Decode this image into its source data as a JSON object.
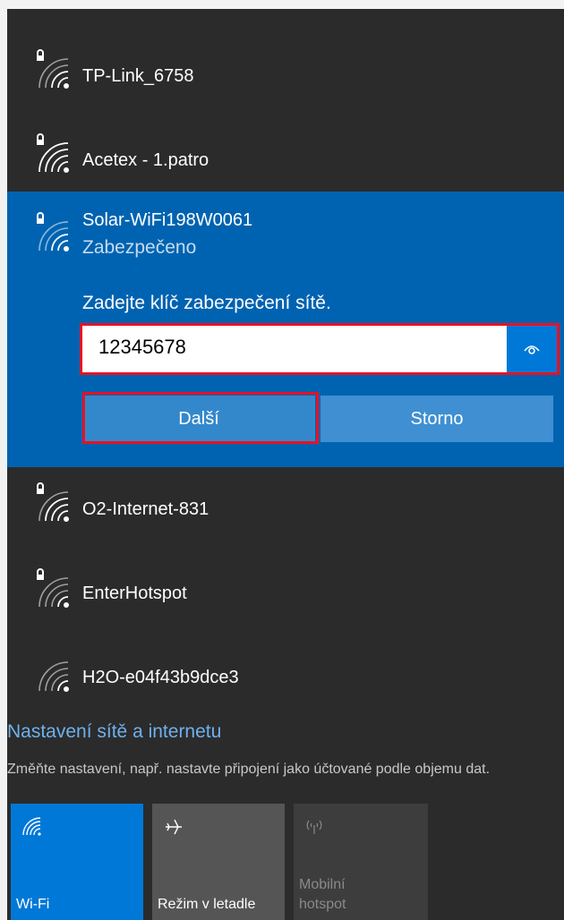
{
  "networks": [
    {
      "ssid": "TP-Link_6758",
      "secured": true
    },
    {
      "ssid": "Acetex - 1.patro",
      "secured": true
    },
    {
      "ssid": "Solar-WiFi198W0061",
      "secured": true,
      "status": "Zabezpečeno"
    },
    {
      "ssid": "O2-Internet-831",
      "secured": true
    },
    {
      "ssid": "EnterHotspot",
      "secured": true
    },
    {
      "ssid": "H2O-e04f43b9dce3",
      "secured": false
    }
  ],
  "connect_form": {
    "prompt": "Zadejte klíč zabezpečení sítě.",
    "password_value": "12345678",
    "next_label": "Další",
    "cancel_label": "Storno"
  },
  "settings": {
    "title": "Nastavení sítě a internetu",
    "description": "Změňte nastavení, např. nastavte připojení jako účtované podle objemu dat."
  },
  "quick_actions": [
    {
      "label": "Wi-Fi",
      "icon": "wifi-icon",
      "state": "on"
    },
    {
      "label": "Režim v letadle",
      "icon": "airplane-icon",
      "state": "off"
    },
    {
      "label": "Mobilní hotspot",
      "icon": "hotspot-icon",
      "state": "disabled"
    }
  ],
  "colors": {
    "flyout_bg": "#2b2b2b",
    "accent": "#0078d7",
    "selected_bg": "#0063b1",
    "highlight": "#e81123"
  }
}
